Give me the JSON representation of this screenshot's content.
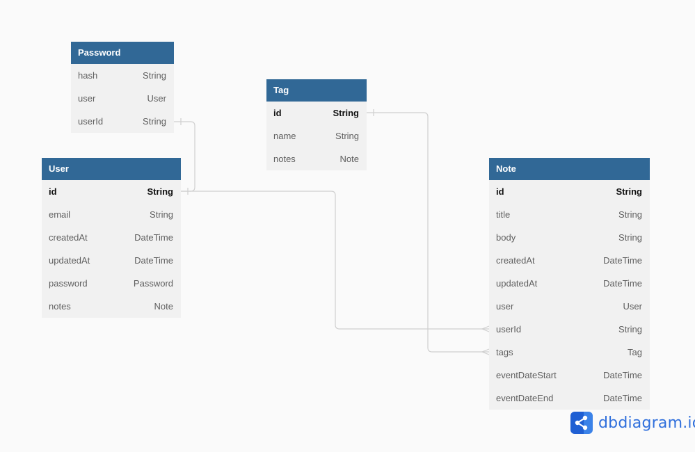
{
  "diagram": {
    "colors": {
      "header_bg": "#316896",
      "header_text": "#ffffff",
      "body_bg": "#f1f1f1",
      "field_text": "#5f5f5f",
      "pk_text": "#111111",
      "connector": "#cfcfcf",
      "canvas": "#fafafa"
    },
    "tables": [
      {
        "name": "Password",
        "fields": [
          {
            "name": "hash",
            "type": "String",
            "pk": false
          },
          {
            "name": "user",
            "type": "User",
            "pk": false
          },
          {
            "name": "userId",
            "type": "String",
            "pk": false
          }
        ]
      },
      {
        "name": "User",
        "fields": [
          {
            "name": "id",
            "type": "String",
            "pk": true
          },
          {
            "name": "email",
            "type": "String",
            "pk": false
          },
          {
            "name": "createdAt",
            "type": "DateTime",
            "pk": false
          },
          {
            "name": "updatedAt",
            "type": "DateTime",
            "pk": false
          },
          {
            "name": "password",
            "type": "Password",
            "pk": false
          },
          {
            "name": "notes",
            "type": "Note",
            "pk": false
          }
        ]
      },
      {
        "name": "Tag",
        "fields": [
          {
            "name": "id",
            "type": "String",
            "pk": true
          },
          {
            "name": "name",
            "type": "String",
            "pk": false
          },
          {
            "name": "notes",
            "type": "Note",
            "pk": false
          }
        ]
      },
      {
        "name": "Note",
        "fields": [
          {
            "name": "id",
            "type": "String",
            "pk": true
          },
          {
            "name": "title",
            "type": "String",
            "pk": false
          },
          {
            "name": "body",
            "type": "String",
            "pk": false
          },
          {
            "name": "createdAt",
            "type": "DateTime",
            "pk": false
          },
          {
            "name": "updatedAt",
            "type": "DateTime",
            "pk": false
          },
          {
            "name": "user",
            "type": "User",
            "pk": false
          },
          {
            "name": "userId",
            "type": "String",
            "pk": false
          },
          {
            "name": "tags",
            "type": "Tag",
            "pk": false
          },
          {
            "name": "eventDateStart",
            "type": "DateTime",
            "pk": false
          },
          {
            "name": "eventDateEnd",
            "type": "DateTime",
            "pk": false
          }
        ]
      }
    ],
    "relationships": [
      {
        "from": "Password.userId",
        "to": "User.id",
        "from_end": "one",
        "to_end": "one"
      },
      {
        "from": "User.id",
        "to": "Note.userId",
        "from_end": "one",
        "to_end": "many"
      },
      {
        "from": "Tag.id",
        "to": "Note.tags",
        "from_end": "one",
        "to_end": "many"
      }
    ]
  },
  "branding": {
    "logo_icon": "share-nodes-icon",
    "text": "dbdiagram.io"
  }
}
